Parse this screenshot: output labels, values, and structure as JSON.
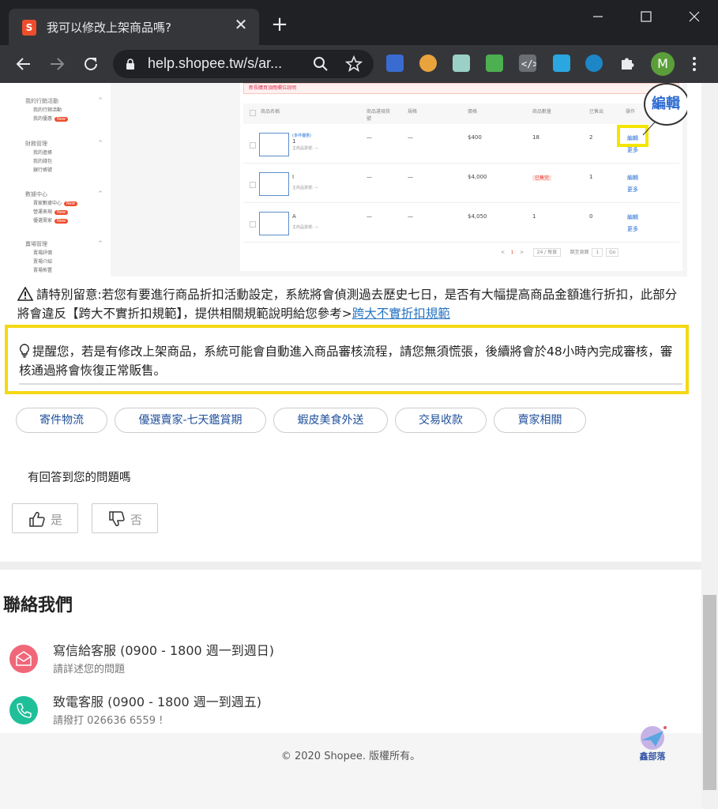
{
  "browser": {
    "tab_title": "我可以修改上架商品嗎?",
    "favicon_letter": "S",
    "url": "help.shopee.tw/s/ar...",
    "profile_initial": "M"
  },
  "screenshot": {
    "alert_text": "新長購買須閱欄位說明",
    "sidebar": [
      {
        "head": "我的行銷活動",
        "items": [
          {
            "label": "我的行銷活動"
          },
          {
            "label": "我的優惠",
            "badge": "New"
          }
        ]
      },
      {
        "head": "財務管理",
        "items": [
          {
            "label": "我的進帳"
          },
          {
            "label": "我的錢包"
          },
          {
            "label": "銀行帳號"
          }
        ]
      },
      {
        "head": "數據中心",
        "items": [
          {
            "label": "賣家數據中心",
            "badge": "New"
          },
          {
            "label": "營運表現",
            "badge": "New"
          },
          {
            "label": "優選賣家",
            "badge": "New"
          }
        ]
      },
      {
        "head": "賣場管理",
        "items": [
          {
            "label": "賣場評價"
          },
          {
            "label": "賣場介紹"
          },
          {
            "label": "賣場佈置"
          }
        ]
      }
    ],
    "columns": [
      "商品名稱",
      "商品選項貨號",
      "規格",
      "價格",
      "商品數量",
      "已售出",
      "操作"
    ],
    "rows": [
      {
        "tag": "(多件優惠)",
        "name": "1",
        "sku": "主商品貨號: —",
        "opt": "—",
        "spec": "—",
        "price": "$400",
        "qty": "18",
        "sold": "2",
        "edit": "編輯",
        "more": "更多"
      },
      {
        "tag": "",
        "name": "I",
        "sku": "主商品貨號: —",
        "opt": "—",
        "spec": "—",
        "price": "$4,000",
        "qty": "已售完",
        "sold": "1",
        "edit": "編輯",
        "more": "更多"
      },
      {
        "tag": "",
        "name": "A",
        "sku": "主商品貨號: —",
        "opt": "—",
        "spec": "—",
        "price": "$4,050",
        "qty": "1",
        "sold": "0",
        "edit": "編輯",
        "more": "更多"
      }
    ],
    "pager": {
      "prev": "<",
      "page": "1",
      "next": ">",
      "per_page": "24 / 每頁",
      "goto_label": "跳至頁面",
      "goto_value": "1",
      "go": "Go"
    },
    "callout": "編輯"
  },
  "article": {
    "warning_text": "請特別留意:若您有要進行商品折扣活動設定，系統將會偵測過去歷史七日，是否有大幅提高商品金額進行折扣，此部分將會違反【跨大不實折扣規範】，提供相關規範說明給您參考>",
    "warning_link": "跨大不實折扣規範",
    "notice_text": "提醒您，若是有修改上架商品，系統可能會自動進入商品審核流程，請您無須慌張，後續將會於48小時內完成審核，審核通過將會恢復正常販售。"
  },
  "categories": [
    "寄件物流",
    "優選賣家-七天鑑賞期",
    "蝦皮美食外送",
    "交易收款",
    "賣家相關"
  ],
  "feedback": {
    "question": "有回答到您的問題嗎",
    "yes": "是",
    "no": "否"
  },
  "contact": {
    "title": "聯絡我們",
    "email_label": "寫信給客服 (0900 - 1800 週一到週日)",
    "email_sub": "請詳述您的問題",
    "phone_label": "致電客服 (0900 - 1800 週一到週五)",
    "phone_sub": "請撥打 026636 6559 !"
  },
  "footer": {
    "copyright": "© 2020 Shopee. 版權所有。"
  },
  "watermark": "鑫部落",
  "colors": {
    "shopee_orange": "#ee4d2d",
    "highlight_yellow": "#f4d813",
    "link_blue": "#2673c0",
    "email_icon": "#f0677a",
    "phone_icon": "#1fbf99"
  }
}
